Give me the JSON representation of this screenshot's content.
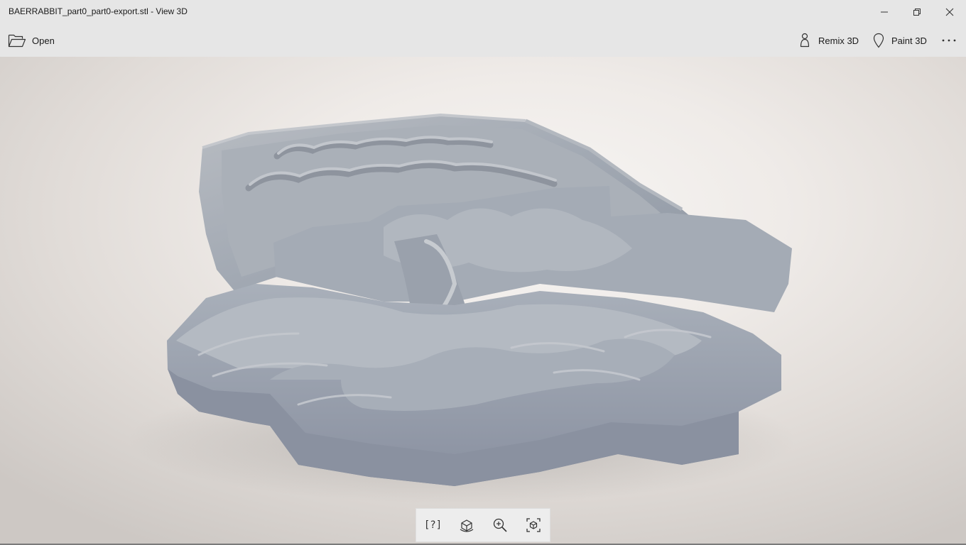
{
  "window": {
    "title": "BAERRABBIT_part0_part0-export.stl - View 3D",
    "controls": [
      "minimize-icon",
      "restore-icon",
      "close-icon"
    ]
  },
  "toolbar": {
    "open_label": "Open",
    "open_icon": "folder-open-icon",
    "remix_label": "Remix 3D",
    "remix_icon": "remix3d-icon",
    "paint_label": "Paint 3D",
    "paint_icon": "paint3d-icon",
    "more_icon": "more-icon"
  },
  "viewport": {
    "description_icon": "3d-model",
    "model_color": "#9aa2ad",
    "background_color": "#efebe8"
  },
  "bottom_bar": {
    "buttons": [
      {
        "icon": "help-icon",
        "glyph": "[?]"
      },
      {
        "icon": "reset-view-icon"
      },
      {
        "icon": "zoom-in-icon"
      },
      {
        "icon": "fit-to-view-icon"
      }
    ]
  }
}
